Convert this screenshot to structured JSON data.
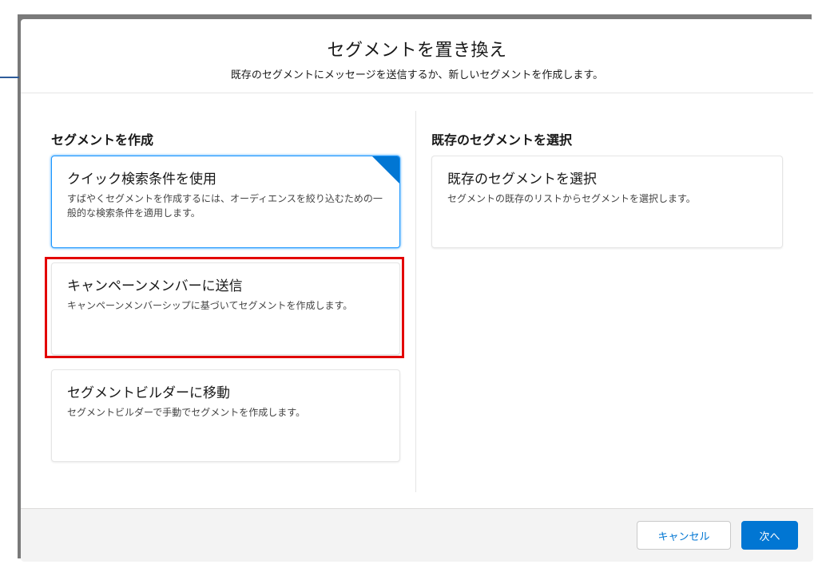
{
  "modal": {
    "title": "セグメントを置き換え",
    "subtitle": "既存のセグメントにメッセージを送信するか、新しいセグメントを作成します。"
  },
  "left": {
    "section_title": "セグメントを作成",
    "cards": [
      {
        "title": "クイック検索条件を使用",
        "description": "すばやくセグメントを作成するには、オーディエンスを絞り込むための一般的な検索条件を適用します。",
        "selected": true
      },
      {
        "title": "キャンペーンメンバーに送信",
        "description": "キャンペーンメンバーシップに基づいてセグメントを作成します。",
        "highlighted": true
      },
      {
        "title": "セグメントビルダーに移動",
        "description": "セグメントビルダーで手動でセグメントを作成します。"
      }
    ]
  },
  "right": {
    "section_title": "既存のセグメントを選択",
    "cards": [
      {
        "title": "既存のセグメントを選択",
        "description": "セグメントの既存のリストからセグメントを選択します。"
      }
    ]
  },
  "footer": {
    "cancel_label": "キャンセル",
    "next_label": "次へ"
  },
  "colors": {
    "brand": "#0176d3",
    "selected_border": "#1b96ff",
    "highlight": "#e30000"
  }
}
